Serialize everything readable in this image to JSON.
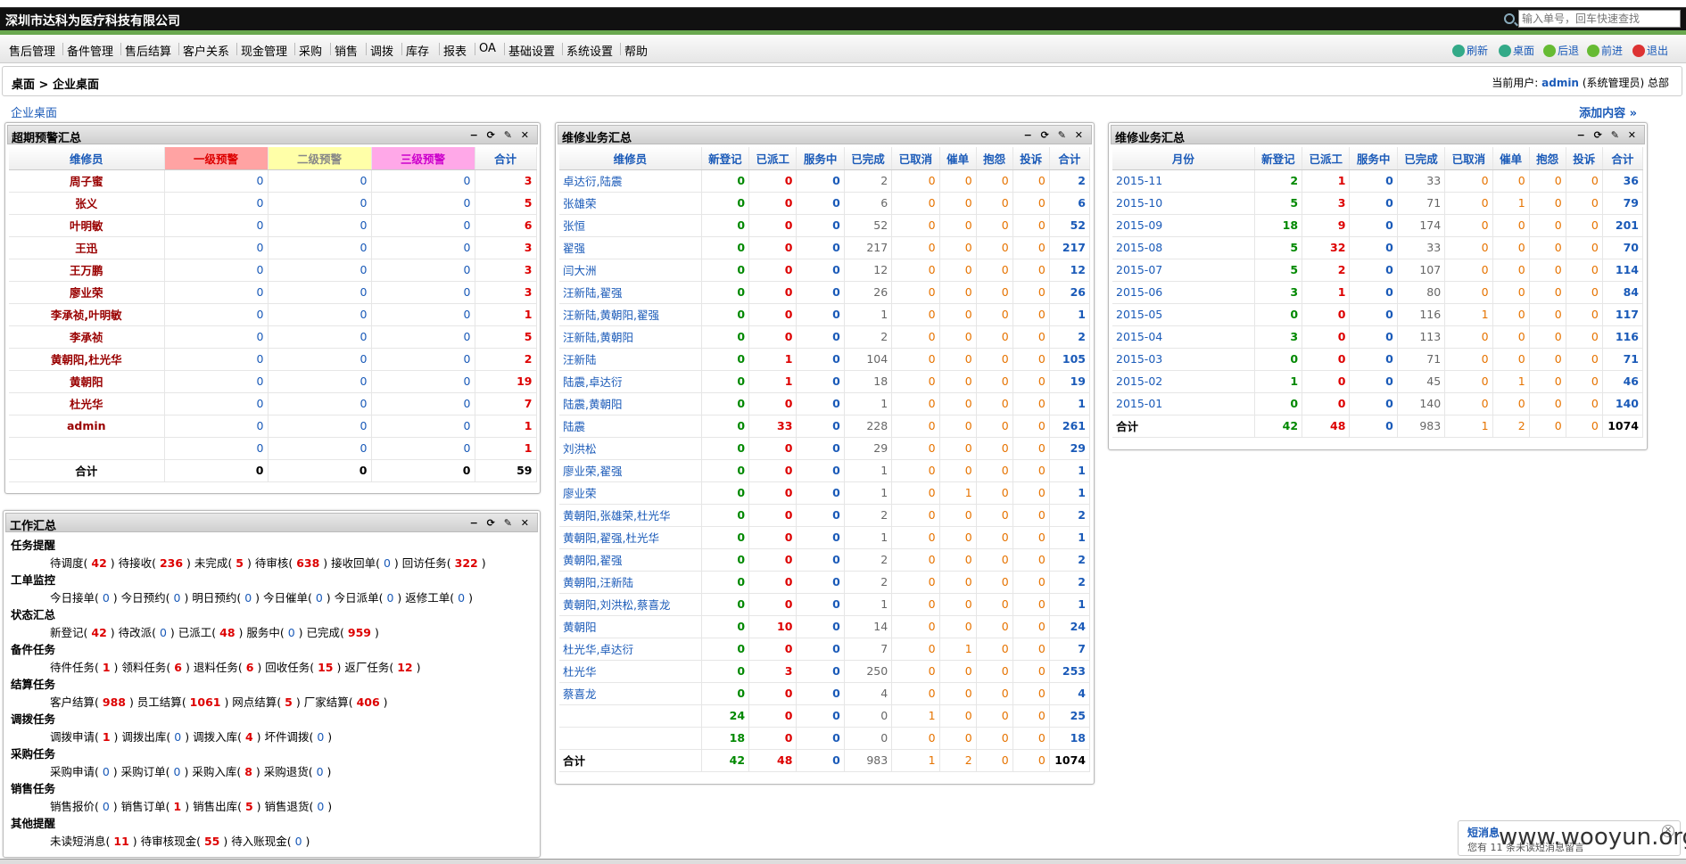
{
  "company": "深圳市达科为医疗科技有限公司",
  "search_placeholder": "输入单号，回车快速查找",
  "menu": [
    "售后管理",
    "备件管理",
    "售后结算",
    "客户关系",
    "现金管理",
    "采购",
    "销售",
    "调拨",
    "库存",
    "报表",
    "OA",
    "基础设置",
    "系统设置",
    "帮助"
  ],
  "tools": [
    {
      "label": "刷新",
      "color": "#3a8"
    },
    {
      "label": "桌面",
      "color": "#3a8"
    },
    {
      "label": "后退",
      "color": "#6b3"
    },
    {
      "label": "前进",
      "color": "#6b3"
    },
    {
      "label": "退出",
      "color": "#d33"
    }
  ],
  "breadcrumb": "桌面 > 企业桌面",
  "user": {
    "prefix": "当前用户:",
    "name": "admin",
    "suffix": "(系统管理员) 总部"
  },
  "desk_link": "企业桌面",
  "add_link": "添加内容 »",
  "panel_icons": "− ⟳ ✎ ✕",
  "alarm": {
    "title": "超期预警汇总",
    "headers": [
      "维修员",
      "一级预警",
      "二级预警",
      "三级预警",
      "合计"
    ],
    "header_colors": [
      "",
      "#ffa3a3",
      "#ffffa8",
      "#ffa8e8",
      ""
    ],
    "rows": [
      [
        "周子蜜",
        "0",
        "0",
        "0",
        "3"
      ],
      [
        "张义",
        "0",
        "0",
        "0",
        "5"
      ],
      [
        "叶明敏",
        "0",
        "0",
        "0",
        "6"
      ],
      [
        "王迅",
        "0",
        "0",
        "0",
        "3"
      ],
      [
        "王万鹏",
        "0",
        "0",
        "0",
        "3"
      ],
      [
        "廖业荣",
        "0",
        "0",
        "0",
        "3"
      ],
      [
        "李承祯,叶明敏",
        "0",
        "0",
        "0",
        "1"
      ],
      [
        "李承祯",
        "0",
        "0",
        "0",
        "5"
      ],
      [
        "黄朝阳,杜光华",
        "0",
        "0",
        "0",
        "2"
      ],
      [
        "黄朝阳",
        "0",
        "0",
        "0",
        "19"
      ],
      [
        "杜光华",
        "0",
        "0",
        "0",
        "7"
      ],
      [
        "admin",
        "0",
        "0",
        "0",
        "1"
      ],
      [
        "",
        "0",
        "0",
        "0",
        "1"
      ]
    ],
    "total": [
      "合计",
      "0",
      "0",
      "0",
      "59"
    ]
  },
  "work": {
    "title": "工作汇总",
    "sections": [
      {
        "name": "任务提醒",
        "items": [
          [
            "待调度",
            "42"
          ],
          [
            "待接收",
            "236"
          ],
          [
            "未完成",
            "5"
          ],
          [
            "待审核",
            "638"
          ],
          [
            "接收回单",
            "0"
          ],
          [
            "回访任务",
            "322"
          ]
        ]
      },
      {
        "name": "工单监控",
        "items": [
          [
            "今日接单",
            "0"
          ],
          [
            "今日预约",
            "0"
          ],
          [
            "明日预约",
            "0"
          ],
          [
            "今日催单",
            "0"
          ],
          [
            "今日派单",
            "0"
          ],
          [
            "返修工单",
            "0"
          ]
        ]
      },
      {
        "name": "状态汇总",
        "items": [
          [
            "新登记",
            "42"
          ],
          [
            "待改派",
            "0"
          ],
          [
            "已派工",
            "48"
          ],
          [
            "服务中",
            "0"
          ],
          [
            "已完成",
            "959"
          ]
        ]
      },
      {
        "name": "备件任务",
        "items": [
          [
            "待件任务",
            "1"
          ],
          [
            "领料任务",
            "6"
          ],
          [
            "退料任务",
            "6"
          ],
          [
            "回收任务",
            "15"
          ],
          [
            "返厂任务",
            "12"
          ]
        ]
      },
      {
        "name": "结算任务",
        "items": [
          [
            "客户结算",
            "988"
          ],
          [
            "员工结算",
            "1061"
          ],
          [
            "网点结算",
            "5"
          ],
          [
            "厂家结算",
            "406"
          ]
        ]
      },
      {
        "name": "调拨任务",
        "items": [
          [
            "调拨申请",
            "1"
          ],
          [
            "调拨出库",
            "0"
          ],
          [
            "调拨入库",
            "4"
          ],
          [
            "坏件调拨",
            "0"
          ]
        ]
      },
      {
        "name": "采购任务",
        "items": [
          [
            "采购申请",
            "0"
          ],
          [
            "采购订单",
            "0"
          ],
          [
            "采购入库",
            "8"
          ],
          [
            "采购退货",
            "0"
          ]
        ]
      },
      {
        "name": "销售任务",
        "items": [
          [
            "销售报价",
            "0"
          ],
          [
            "销售订单",
            "1"
          ],
          [
            "销售出库",
            "5"
          ],
          [
            "销售退货",
            "0"
          ]
        ]
      },
      {
        "name": "其他提醒",
        "items": [
          [
            "未读短消息",
            "11"
          ],
          [
            "待审核现金",
            "55"
          ],
          [
            "待入账现金",
            "0"
          ]
        ]
      }
    ]
  },
  "repair": {
    "title": "维修业务汇总",
    "headers": [
      "维修员",
      "新登记",
      "已派工",
      "服务中",
      "已完成",
      "已取消",
      "催单",
      "抱怨",
      "投诉",
      "合计"
    ],
    "rows": [
      [
        "卓达衍,陆震",
        "0",
        "0",
        "0",
        "2",
        "0",
        "0",
        "0",
        "0",
        "2"
      ],
      [
        "张雄荣",
        "0",
        "0",
        "0",
        "6",
        "0",
        "0",
        "0",
        "0",
        "6"
      ],
      [
        "张恒",
        "0",
        "0",
        "0",
        "52",
        "0",
        "0",
        "0",
        "0",
        "52"
      ],
      [
        "翟强",
        "0",
        "0",
        "0",
        "217",
        "0",
        "0",
        "0",
        "0",
        "217"
      ],
      [
        "闫大洲",
        "0",
        "0",
        "0",
        "12",
        "0",
        "0",
        "0",
        "0",
        "12"
      ],
      [
        "汪新陆,翟强",
        "0",
        "0",
        "0",
        "26",
        "0",
        "0",
        "0",
        "0",
        "26"
      ],
      [
        "汪新陆,黄朝阳,翟强",
        "0",
        "0",
        "0",
        "1",
        "0",
        "0",
        "0",
        "0",
        "1"
      ],
      [
        "汪新陆,黄朝阳",
        "0",
        "0",
        "0",
        "2",
        "0",
        "0",
        "0",
        "0",
        "2"
      ],
      [
        "汪新陆",
        "0",
        "1",
        "0",
        "104",
        "0",
        "0",
        "0",
        "0",
        "105"
      ],
      [
        "陆震,卓达衍",
        "0",
        "1",
        "0",
        "18",
        "0",
        "0",
        "0",
        "0",
        "19"
      ],
      [
        "陆震,黄朝阳",
        "0",
        "0",
        "0",
        "1",
        "0",
        "0",
        "0",
        "0",
        "1"
      ],
      [
        "陆震",
        "0",
        "33",
        "0",
        "228",
        "0",
        "0",
        "0",
        "0",
        "261"
      ],
      [
        "刘洪松",
        "0",
        "0",
        "0",
        "29",
        "0",
        "0",
        "0",
        "0",
        "29"
      ],
      [
        "廖业荣,翟强",
        "0",
        "0",
        "0",
        "1",
        "0",
        "0",
        "0",
        "0",
        "1"
      ],
      [
        "廖业荣",
        "0",
        "0",
        "0",
        "1",
        "0",
        "1",
        "0",
        "0",
        "1"
      ],
      [
        "黄朝阳,张雄荣,杜光华",
        "0",
        "0",
        "0",
        "2",
        "0",
        "0",
        "0",
        "0",
        "2"
      ],
      [
        "黄朝阳,翟强,杜光华",
        "0",
        "0",
        "0",
        "1",
        "0",
        "0",
        "0",
        "0",
        "1"
      ],
      [
        "黄朝阳,翟强",
        "0",
        "0",
        "0",
        "2",
        "0",
        "0",
        "0",
        "0",
        "2"
      ],
      [
        "黄朝阳,汪新陆",
        "0",
        "0",
        "0",
        "2",
        "0",
        "0",
        "0",
        "0",
        "2"
      ],
      [
        "黄朝阳,刘洪松,蔡喜龙",
        "0",
        "0",
        "0",
        "1",
        "0",
        "0",
        "0",
        "0",
        "1"
      ],
      [
        "黄朝阳",
        "0",
        "10",
        "0",
        "14",
        "0",
        "0",
        "0",
        "0",
        "24"
      ],
      [
        "杜光华,卓达衍",
        "0",
        "0",
        "0",
        "7",
        "0",
        "1",
        "0",
        "0",
        "7"
      ],
      [
        "杜光华",
        "0",
        "3",
        "0",
        "250",
        "0",
        "0",
        "0",
        "0",
        "253"
      ],
      [
        "蔡喜龙",
        "0",
        "0",
        "0",
        "4",
        "0",
        "0",
        "0",
        "0",
        "4"
      ],
      [
        "",
        "24",
        "0",
        "0",
        "0",
        "1",
        "0",
        "0",
        "0",
        "25"
      ],
      [
        "",
        "18",
        "0",
        "0",
        "0",
        "0",
        "0",
        "0",
        "0",
        "18"
      ]
    ],
    "total": [
      "合计",
      "42",
      "48",
      "0",
      "983",
      "1",
      "2",
      "0",
      "0",
      "1074"
    ]
  },
  "monthly": {
    "title": "维修业务汇总",
    "headers": [
      "月份",
      "新登记",
      "已派工",
      "服务中",
      "已完成",
      "已取消",
      "催单",
      "抱怨",
      "投诉",
      "合计"
    ],
    "rows": [
      [
        "2015-11",
        "2",
        "1",
        "0",
        "33",
        "0",
        "0",
        "0",
        "0",
        "36"
      ],
      [
        "2015-10",
        "5",
        "3",
        "0",
        "71",
        "0",
        "1",
        "0",
        "0",
        "79"
      ],
      [
        "2015-09",
        "18",
        "9",
        "0",
        "174",
        "0",
        "0",
        "0",
        "0",
        "201"
      ],
      [
        "2015-08",
        "5",
        "32",
        "0",
        "33",
        "0",
        "0",
        "0",
        "0",
        "70"
      ],
      [
        "2015-07",
        "5",
        "2",
        "0",
        "107",
        "0",
        "0",
        "0",
        "0",
        "114"
      ],
      [
        "2015-06",
        "3",
        "1",
        "0",
        "80",
        "0",
        "0",
        "0",
        "0",
        "84"
      ],
      [
        "2015-05",
        "0",
        "0",
        "0",
        "116",
        "1",
        "0",
        "0",
        "0",
        "117"
      ],
      [
        "2015-04",
        "3",
        "0",
        "0",
        "113",
        "0",
        "0",
        "0",
        "0",
        "116"
      ],
      [
        "2015-03",
        "0",
        "0",
        "0",
        "71",
        "0",
        "0",
        "0",
        "0",
        "71"
      ],
      [
        "2015-02",
        "1",
        "0",
        "0",
        "45",
        "0",
        "1",
        "0",
        "0",
        "46"
      ],
      [
        "2015-01",
        "0",
        "0",
        "0",
        "140",
        "0",
        "0",
        "0",
        "0",
        "140"
      ]
    ],
    "total": [
      "合计",
      "42",
      "48",
      "0",
      "983",
      "1",
      "2",
      "0",
      "0",
      "1074"
    ]
  },
  "message": {
    "title": "短消息",
    "text": "您有 11 条未读短消息留言"
  },
  "watermark": "www.wooyun.org"
}
